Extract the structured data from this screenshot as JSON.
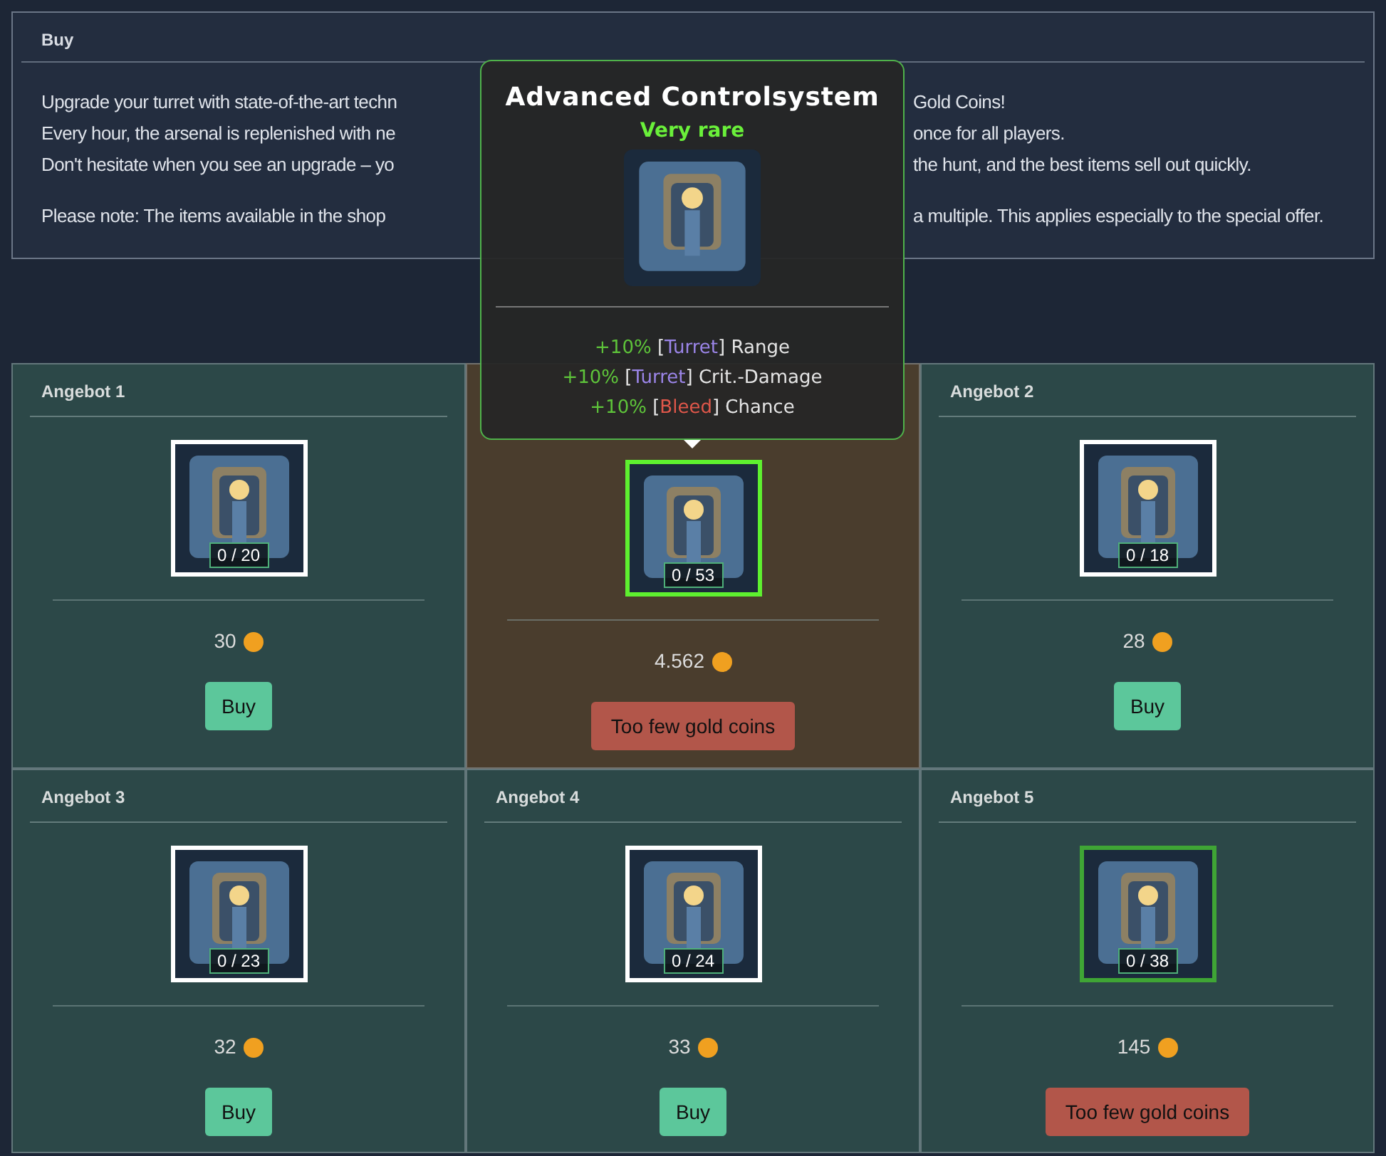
{
  "panel": {
    "title": "Buy",
    "intro_lines": [
      {
        "left": "Upgrade your turret with state-of-the-art techn",
        "right": "Gold Coins!"
      },
      {
        "left": "Every hour, the arsenal is replenished with ne",
        "right": "once for all players."
      },
      {
        "left": "Don't hesitate when you see an upgrade – yo",
        "right": "the hunt, and the best items sell out quickly."
      },
      {
        "kind": "gap"
      },
      {
        "left": "Please note: The items available in the shop",
        "right": "a multiple. This applies especially to the special offer."
      }
    ]
  },
  "offers": [
    {
      "kind": "regular",
      "title": "Angebot 1",
      "count": "0 / 20",
      "color": "#ffffff",
      "price": "30",
      "button": {
        "label": "Buy",
        "kind": "buy"
      }
    },
    {
      "kind": "special",
      "count": "0 / 53",
      "color": "#5ef02f",
      "price": "4.562",
      "button": {
        "label": "Too few gold coins",
        "kind": "blocked"
      }
    },
    {
      "kind": "regular",
      "title": "Angebot 2",
      "count": "0 / 18",
      "color": "#ffffff",
      "price": "28",
      "button": {
        "label": "Buy",
        "kind": "buy"
      }
    },
    {
      "kind": "regular",
      "title": "Angebot 3",
      "count": "0 / 23",
      "color": "#ffffff",
      "price": "32",
      "button": {
        "label": "Buy",
        "kind": "buy"
      }
    },
    {
      "kind": "regular",
      "title": "Angebot 4",
      "count": "0 / 24",
      "color": "#ffffff",
      "price": "33",
      "button": {
        "label": "Buy",
        "kind": "buy"
      }
    },
    {
      "kind": "regular",
      "title": "Angebot 5",
      "count": "0 / 38",
      "color": "#3fa535",
      "price": "145",
      "button": {
        "label": "Too few gold coins",
        "kind": "blocked"
      }
    }
  ],
  "tooltip": {
    "title": "Advanced Controlsystem",
    "rarity": "Very rare",
    "stats": [
      [
        {
          "text": "+10%",
          "color": "#5ec43a"
        },
        {
          "text": " [",
          "color": "#e5e5e5"
        },
        {
          "text": "Turret",
          "color": "#9b85e8"
        },
        {
          "text": "] Range",
          "color": "#e5e5e5"
        }
      ],
      [
        {
          "text": "+10%",
          "color": "#5ec43a"
        },
        {
          "text": " [",
          "color": "#e5e5e5"
        },
        {
          "text": "Turret",
          "color": "#9b85e8"
        },
        {
          "text": "] Crit.-Damage",
          "color": "#e5e5e5"
        }
      ],
      [
        {
          "text": "+10%",
          "color": "#5ec43a"
        },
        {
          "text": " [",
          "color": "#e5e5e5"
        },
        {
          "text": "Bleed",
          "color": "#e0574a"
        },
        {
          "text": "] Chance",
          "color": "#e5e5e5"
        }
      ]
    ]
  }
}
